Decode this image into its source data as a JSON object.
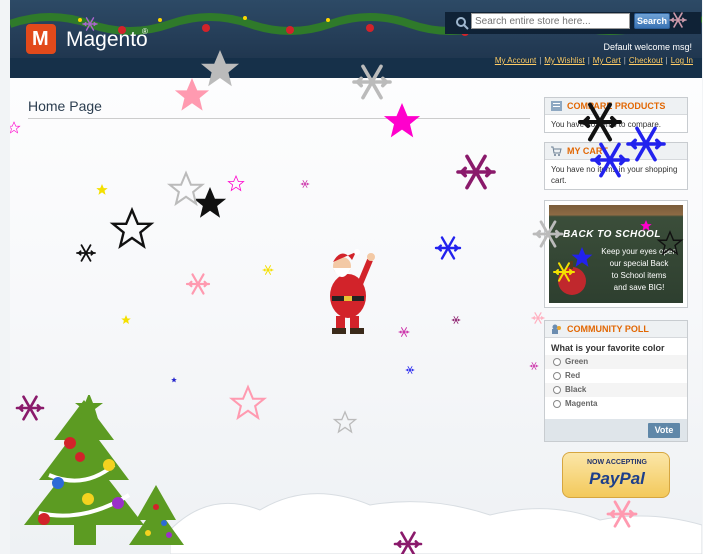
{
  "header": {
    "logo_text": "Magento",
    "logo_reg": "®",
    "logo_letter": "M",
    "search": {
      "placeholder": "Search entire store here...",
      "button_label": "Search"
    },
    "welcome": "Default welcome msg!",
    "links": [
      "My Account",
      "My Wishlist",
      "My Cart",
      "Checkout",
      "Log In"
    ]
  },
  "main": {
    "page_title": "Home Page"
  },
  "sidebar": {
    "compare": {
      "title": "Compare Products",
      "text": "You have no items to compare."
    },
    "cart": {
      "title": "My Cart",
      "text": "You have no items in your shopping cart."
    },
    "back_to_school": {
      "title": "BACK TO SCHOOL",
      "lines": [
        "Keep your eyes open",
        "our special Back",
        "to School items",
        "and save BIG!"
      ]
    },
    "poll": {
      "title": "Community Poll",
      "question": "What is your favorite color",
      "options": [
        "Green",
        "Red",
        "Black",
        "Magenta"
      ],
      "vote_label": "Vote"
    },
    "paypal": {
      "top": "NOW ACCEPTING",
      "brand": "PayPal"
    }
  },
  "colors": {
    "accent_orange": "#e26703",
    "header_blue": "#1c3048",
    "link_yellow": "#ffcc66"
  }
}
